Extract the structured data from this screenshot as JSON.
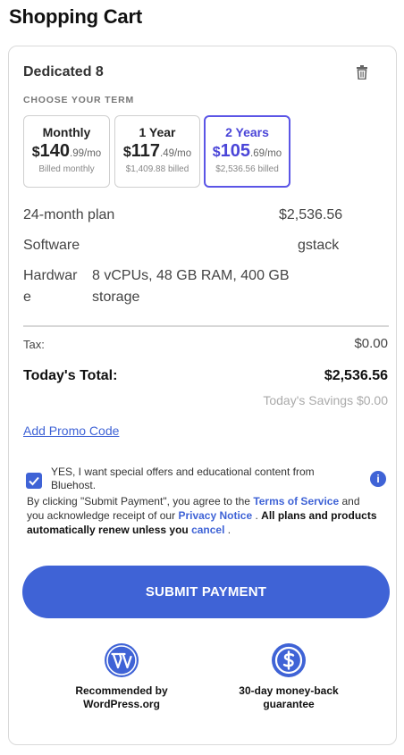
{
  "page_title": "Shopping Cart",
  "product": {
    "name": "Dedicated 8"
  },
  "term_label": "CHOOSE YOUR TERM",
  "terms": [
    {
      "name": "Monthly",
      "dollar": "$",
      "price": "140",
      "cents": ".99/mo",
      "billed": "Billed monthly",
      "selected": false
    },
    {
      "name": "1 Year",
      "dollar": "$",
      "price": "117",
      "cents": ".49/mo",
      "billed": "$1,409.88 billed",
      "selected": false
    },
    {
      "name": "2 Years",
      "dollar": "$",
      "price": "105",
      "cents": ".69/mo",
      "billed": "$2,536.56 billed",
      "selected": true
    }
  ],
  "details": {
    "plan_label": "24-month plan",
    "plan_value": "$2,536.56",
    "software_label": "Software",
    "software_value": "gstack",
    "hardware_label_1": "Hardwar",
    "hardware_label_2": "e",
    "hardware_value_1": "8 vCPUs, 48 GB RAM, 400 GB",
    "hardware_value_2": "storage"
  },
  "summary": {
    "tax_label": "Tax:",
    "tax_value": "$0.00",
    "total_label": "Today's Total:",
    "total_value": "$2,536.56",
    "savings": "Today's Savings $0.00"
  },
  "promo_label": "Add Promo Code",
  "optin": {
    "checked": true,
    "text": "YES, I want special offers and educational content from Bluehost.",
    "info_glyph": "i"
  },
  "legal": {
    "part1": "By clicking \"Submit Payment\", you agree to the ",
    "terms_link": "Terms of Service",
    "part2": " and you acknowledge receipt of our ",
    "privacy_link": "Privacy Notice",
    "part3": " . ",
    "bold": "All plans and products automatically renew unless you",
    "cancel_link": "cancel",
    "part4": " ."
  },
  "submit_label": "SUBMIT PAYMENT",
  "badges": [
    {
      "icon": "wordpress-icon",
      "line1": "Recommended by",
      "line2": "WordPress.org"
    },
    {
      "icon": "money-back-icon",
      "line1": "30-day money-back",
      "line2": "guarantee"
    }
  ],
  "colors": {
    "accent": "#3f63d6",
    "selected_term": "#4a45d8",
    "muted": "#aaaaaa"
  }
}
